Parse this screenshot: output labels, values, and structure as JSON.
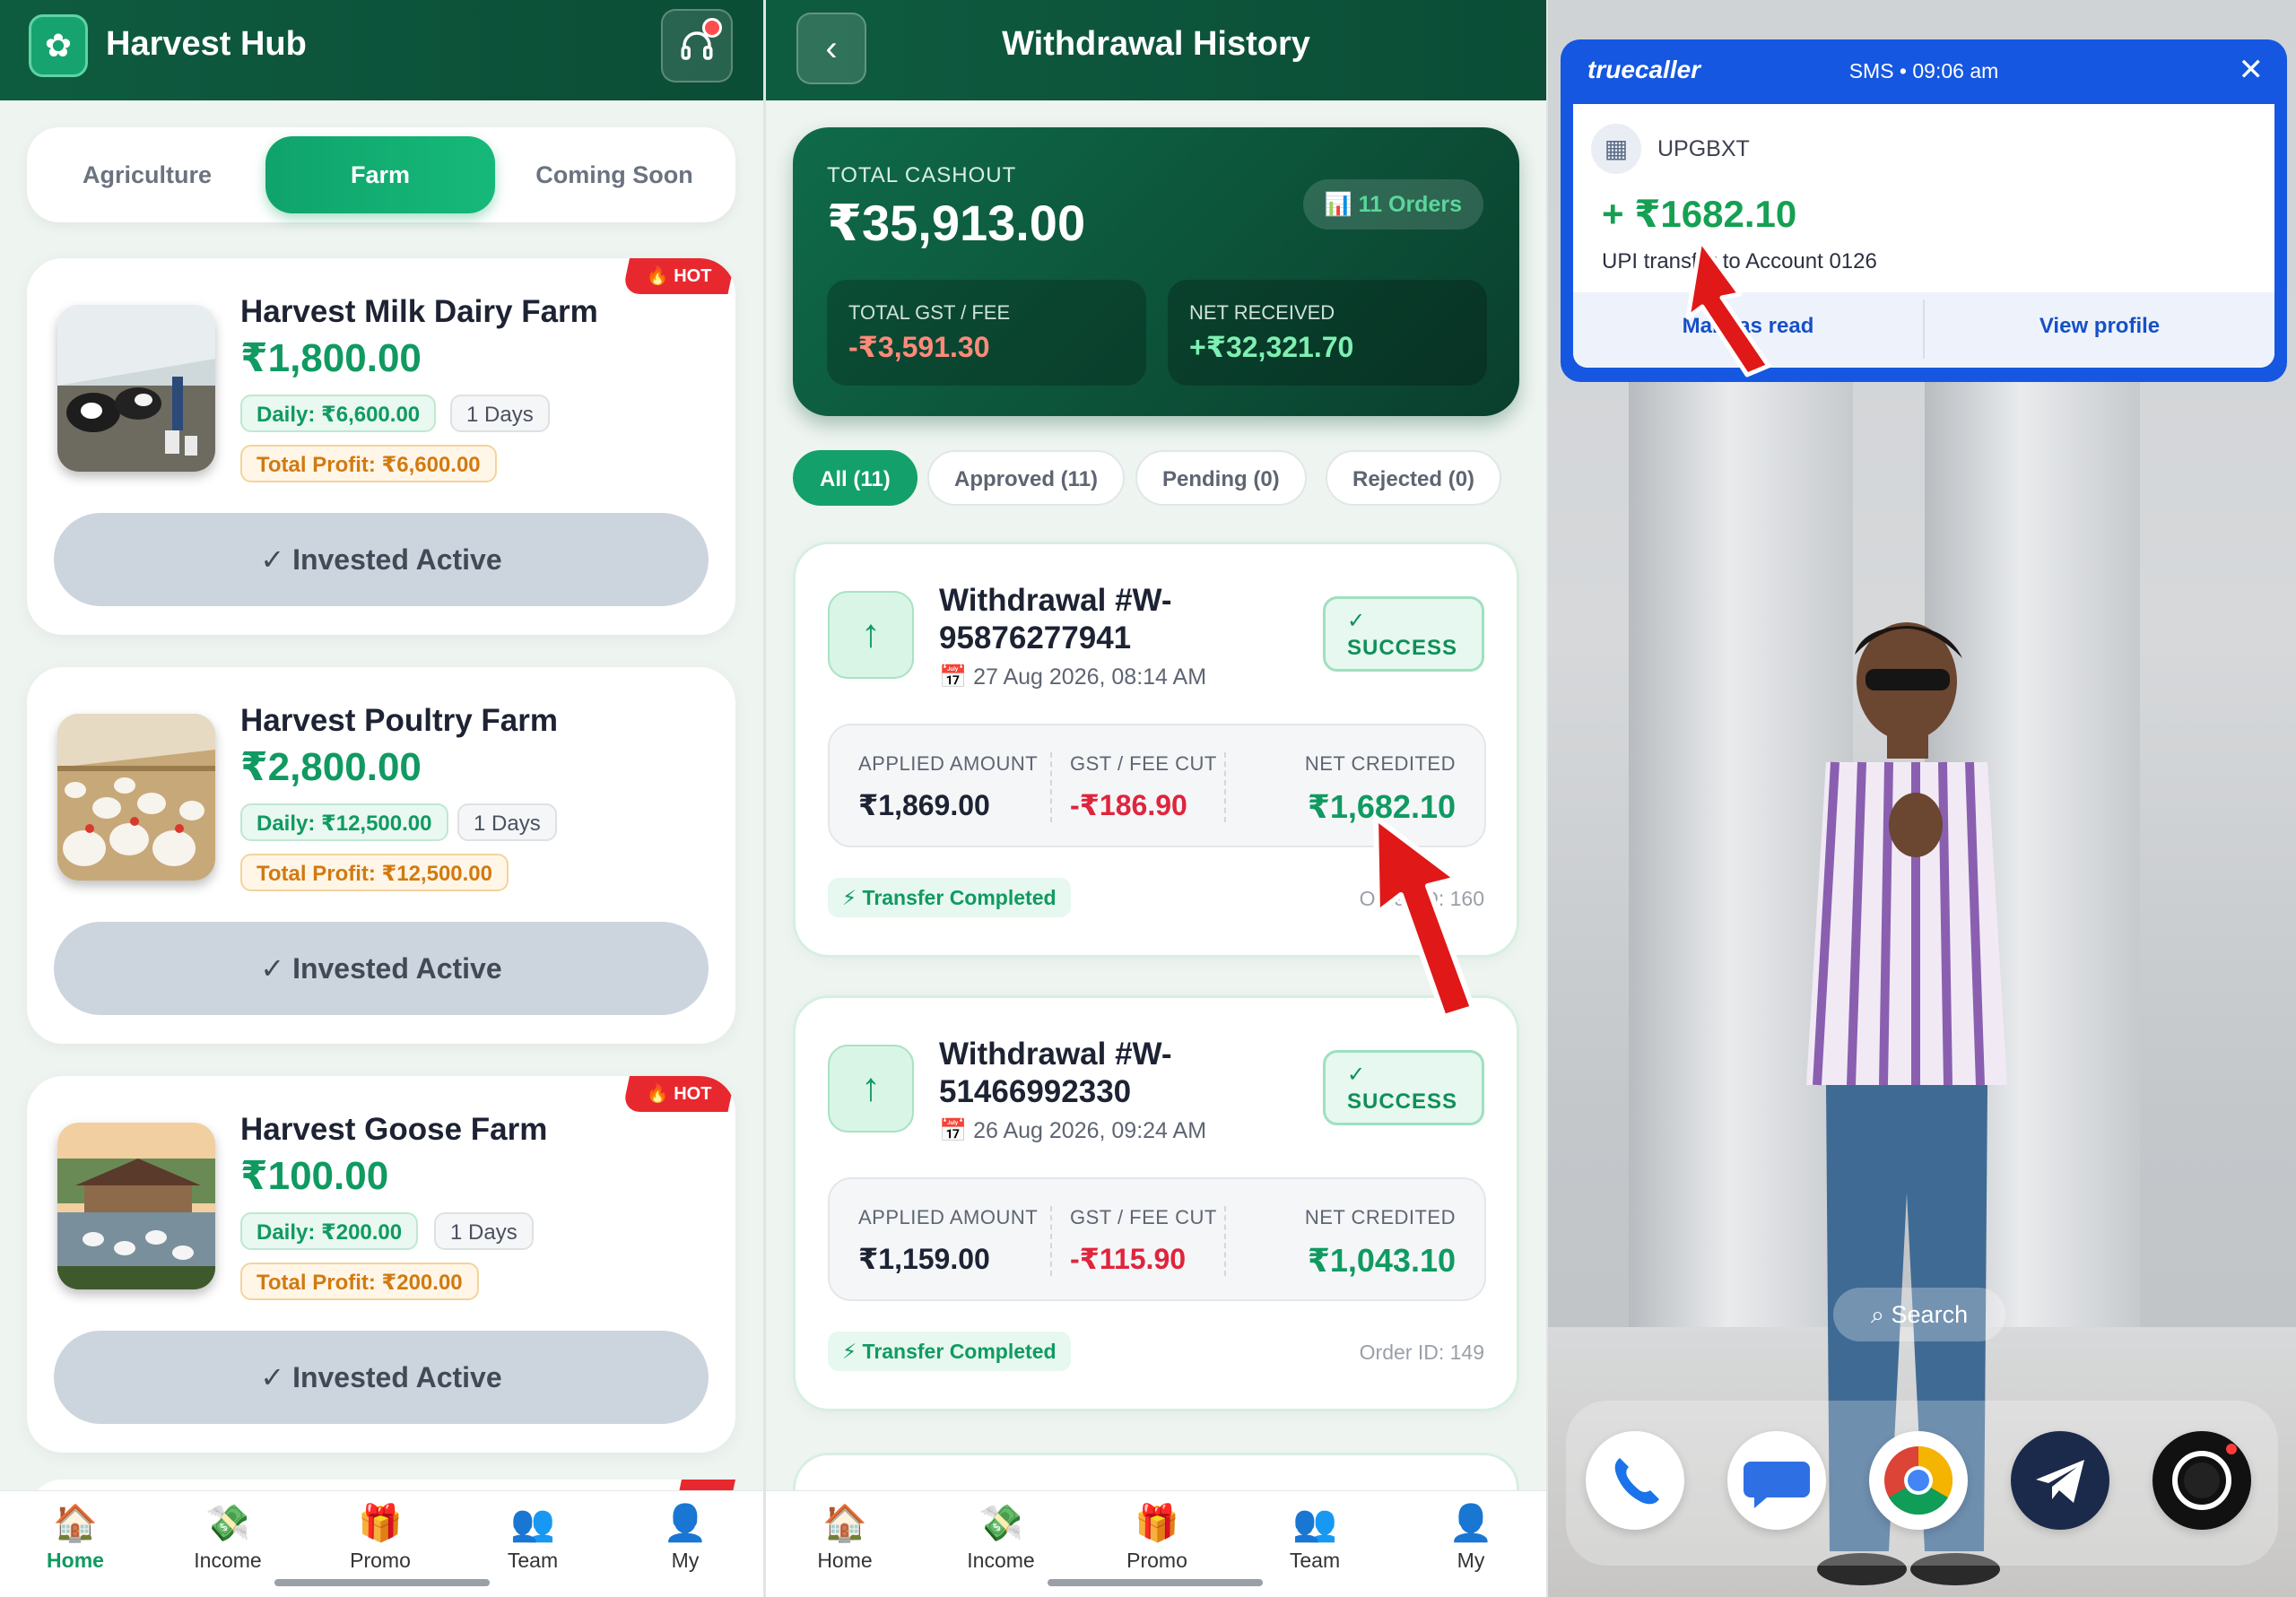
{
  "panel1": {
    "app_title": "Harvest Hub",
    "tabs": [
      {
        "label": "Agriculture"
      },
      {
        "label": "Farm"
      },
      {
        "label": "Coming Soon"
      }
    ],
    "hot_label": "🔥 HOT",
    "invest_label": "✓ Invested Active",
    "farms": [
      {
        "name": "Harvest Milk Dairy Farm",
        "price": "₹1,800.00",
        "daily": "Daily: ₹6,600.00",
        "days": "1 Days",
        "total": "Total Profit: ₹6,600.00"
      },
      {
        "name": "Harvest Poultry Farm",
        "price": "₹2,800.00",
        "daily": "Daily: ₹12,500.00",
        "days": "1 Days",
        "total": "Total Profit: ₹12,500.00"
      },
      {
        "name": "Harvest Goose Farm",
        "price": "₹100.00",
        "daily": "Daily: ₹200.00",
        "days": "1 Days",
        "total": "Total Profit: ₹200.00"
      }
    ]
  },
  "nav": [
    {
      "label": "Home",
      "icon": "home-icon"
    },
    {
      "label": "Income",
      "icon": "income-icon"
    },
    {
      "label": "Promo",
      "icon": "promo-icon"
    },
    {
      "label": "Team",
      "icon": "team-icon"
    },
    {
      "label": "My",
      "icon": "profile-icon"
    }
  ],
  "panel2": {
    "title": "Withdrawal History",
    "summary": {
      "total_label": "TOTAL CASHOUT",
      "total_value": "₹35,913.00",
      "orders": "📊 11 Orders",
      "gst_label": "TOTAL GST / FEE",
      "gst_value": "-₹3,591.30",
      "net_label": "NET RECEIVED",
      "net_value": "+₹32,321.70"
    },
    "filters": [
      {
        "label": "All (11)"
      },
      {
        "label": "Approved (11)"
      },
      {
        "label": "Pending (0)"
      },
      {
        "label": "Rejected (0)"
      }
    ],
    "labels": {
      "applied": "APPLIED AMOUNT",
      "gst": "GST / FEE CUT",
      "net": "NET CREDITED",
      "status": "✓\nSUCCESS",
      "transfer": "⚡ Transfer Completed"
    },
    "withdrawals": [
      {
        "title": "Withdrawal #W-95876277941",
        "date": "27 Aug 2026, 08:14 AM",
        "applied": "₹1,869.00",
        "gst": "-₹186.90",
        "net": "₹1,682.10",
        "order": "Order ID: 160"
      },
      {
        "title": "Withdrawal #W-51466992330",
        "date": "26 Aug 2026, 09:24 AM",
        "applied": "₹1,159.00",
        "gst": "-₹115.90",
        "net": "₹1,043.10",
        "order": "Order ID: 149"
      }
    ]
  },
  "panel3": {
    "brand": "truecaller",
    "meta": "SMS • 09:06 am",
    "sender": "UPGBXT",
    "credit": "+ ₹1682.10",
    "sms_text": "UPI transfer to Account 0126",
    "mark_read": "Mark as read",
    "view_profile": "View profile",
    "search": "Search",
    "dock": [
      "phone-icon",
      "messages-icon",
      "chrome-icon",
      "telegram-icon",
      "camera-icon"
    ]
  },
  "colors": {
    "brand_green": "#0f9a5f",
    "header_green": "#0e5c40",
    "alert_red": "#e8282f",
    "truecaller_blue": "#1557e0"
  }
}
